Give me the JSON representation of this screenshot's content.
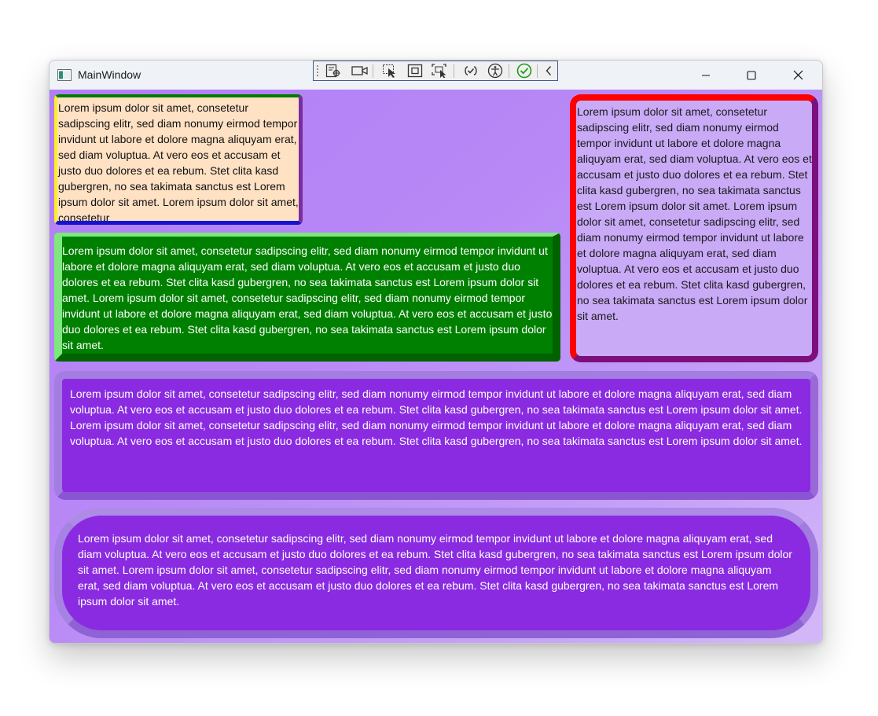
{
  "window": {
    "title": "MainWindow",
    "controls": {
      "minimize": "minimize-icon",
      "maximize": "maximize-icon",
      "close": "close-icon"
    }
  },
  "debug_toolbar": {
    "icons": [
      "live-visual-tree-icon",
      "record-icon",
      "select-element-icon",
      "display-layout-adorners-icon",
      "track-focus-icon",
      "binding-failures-icon",
      "accessibility-icon",
      "checkmark-icon",
      "collapse-icon"
    ]
  },
  "boxes": {
    "box1": {
      "text": "Lorem ipsum dolor sit amet, consetetur sadipscing elitr, sed diam nonumy eirmod tempor invidunt ut labore et dolore magna aliquyam erat, sed diam voluptua. At vero eos et accusam et justo duo dolores et ea rebum. Stet clita kasd gubergren, no sea takimata sanctus est Lorem ipsum dolor sit amet. Lorem ipsum dolor sit amet, consetetur",
      "background": "#ffe1c4"
    },
    "box2": {
      "text": "Lorem ipsum dolor sit amet, consetetur sadipscing elitr, sed diam nonumy eirmod tempor invidunt ut labore et dolore magna aliquyam erat, sed diam voluptua. At vero eos et accusam et justo duo dolores et ea rebum. Stet clita kasd gubergren, no sea takimata sanctus est Lorem ipsum dolor sit amet. Lorem ipsum dolor sit amet, consetetur sadipscing elitr, sed diam nonumy eirmod tempor invidunt ut labore et dolore magna aliquyam erat, sed diam voluptua. At vero eos et accusam et justo duo dolores et ea rebum. Stet clita kasd gubergren, no sea takimata sanctus est Lorem ipsum dolor sit amet.",
      "background": "#008000"
    },
    "box3": {
      "text": "Lorem ipsum dolor sit amet, consetetur sadipscing elitr, sed diam nonumy eirmod tempor invidunt ut labore et dolore magna aliquyam erat, sed diam voluptua. At vero eos et accusam et justo duo dolores et ea rebum. Stet clita kasd gubergren, no sea takimata sanctus est Lorem ipsum dolor sit amet. Lorem ipsum dolor sit amet, consetetur sadipscing elitr, sed diam nonumy eirmod tempor invidunt ut labore et dolore magna aliquyam erat, sed diam voluptua. At vero eos et accusam et justo duo dolores et ea rebum. Stet clita kasd gubergren, no sea takimata sanctus est Lorem ipsum dolor sit amet.",
      "background": "#c9aaf7"
    },
    "box4": {
      "text": "Lorem ipsum dolor sit amet, consetetur sadipscing elitr, sed diam nonumy eirmod tempor invidunt ut labore et dolore magna aliquyam erat, sed diam voluptua. At vero eos et accusam et justo duo dolores et ea rebum. Stet clita kasd gubergren, no sea takimata sanctus est Lorem ipsum dolor sit amet. Lorem ipsum dolor sit amet, consetetur sadipscing elitr, sed diam nonumy eirmod tempor invidunt ut labore et dolore magna aliquyam erat, sed diam voluptua. At vero eos et accusam et justo duo dolores et ea rebum. Stet clita kasd gubergren, no sea takimata sanctus est Lorem ipsum dolor sit amet.",
      "background": "#8a2be2"
    },
    "box5": {
      "text": "Lorem ipsum dolor sit amet, consetetur sadipscing elitr, sed diam nonumy eirmod tempor invidunt ut labore et dolore magna aliquyam erat, sed diam voluptua. At vero eos et accusam et justo duo dolores et ea rebum. Stet clita kasd gubergren, no sea takimata sanctus est Lorem ipsum dolor sit amet. Lorem ipsum dolor sit amet, consetetur sadipscing elitr, sed diam nonumy eirmod tempor invidunt ut labore et dolore magna aliquyam erat, sed diam voluptua. At vero eos et accusam et justo duo dolores et ea rebum. Stet clita kasd gubergren, no sea takimata sanctus est Lorem ipsum dolor sit amet.",
      "background": "#8a2be2"
    }
  },
  "colors": {
    "client_background": "#b888f6",
    "box1_border_top": "#007a00",
    "box1_border_left": "#ffee22",
    "box1_border_bottom": "#1414d0",
    "box1_border_right": "#7a2e9e",
    "box2_highlight": "#7ee87e",
    "box3_border_light": "#ff0000",
    "box3_border_dark": "#7d0f7d"
  }
}
